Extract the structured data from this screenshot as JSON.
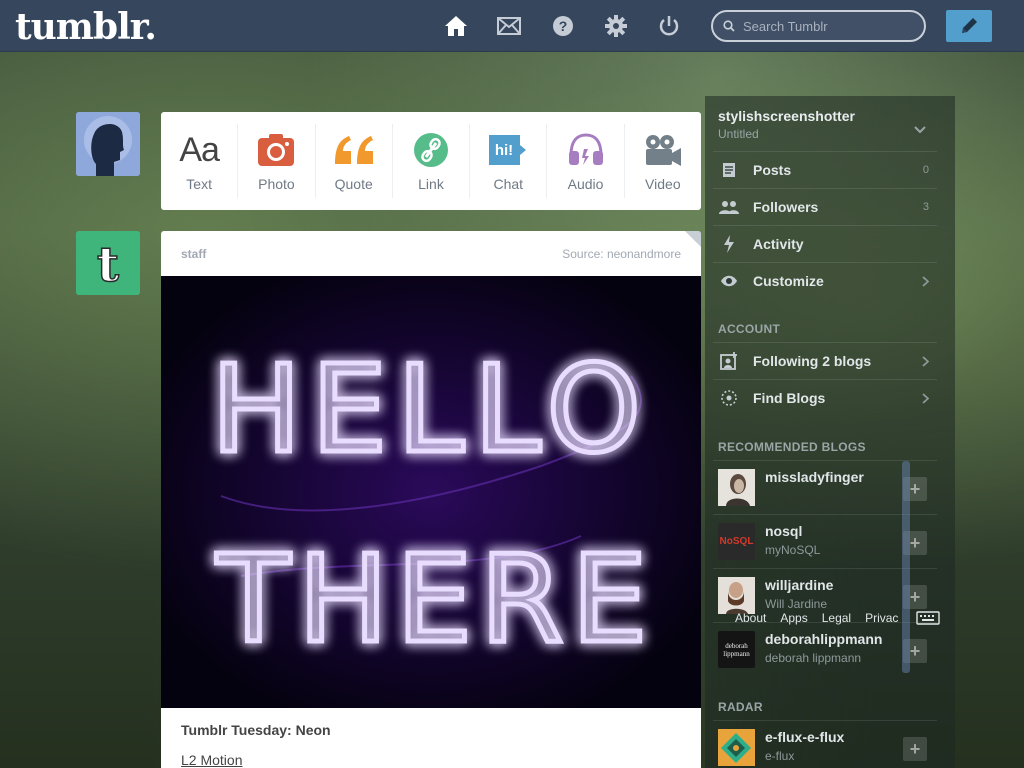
{
  "header": {
    "logo": "tumblr.",
    "search_placeholder": "Search Tumblr",
    "nav_icons": [
      "home-icon",
      "mail-icon",
      "help-icon",
      "gear-icon",
      "power-icon"
    ],
    "compose_icon": "pencil-icon"
  },
  "post_types": [
    {
      "label": "Text",
      "icon": "text-icon"
    },
    {
      "label": "Photo",
      "icon": "camera-icon"
    },
    {
      "label": "Quote",
      "icon": "quote-icon"
    },
    {
      "label": "Link",
      "icon": "link-icon"
    },
    {
      "label": "Chat",
      "icon": "chat-icon"
    },
    {
      "label": "Audio",
      "icon": "headphones-icon"
    },
    {
      "label": "Video",
      "icon": "video-camera-icon"
    }
  ],
  "post": {
    "author": "staff",
    "source": "Source: neonandmore",
    "image_text_line1": "HELLO",
    "image_text_line2": "THERE",
    "title": "Tumblr Tuesday: Neon",
    "link": "L2 Motion"
  },
  "sidebar": {
    "blog_name": "stylishscreenshotter",
    "blog_sub": "Untitled",
    "menu": [
      {
        "label": "Posts",
        "count": "0",
        "icon": "posts-icon"
      },
      {
        "label": "Followers",
        "count": "3",
        "icon": "followers-icon"
      },
      {
        "label": "Activity",
        "count": "",
        "icon": "activity-icon"
      },
      {
        "label": "Customize",
        "count": "",
        "icon": "eye-icon"
      }
    ],
    "account_heading": "ACCOUNT",
    "account": [
      {
        "label": "Following 2 blogs",
        "icon": "following-icon"
      },
      {
        "label": "Find Blogs",
        "icon": "compass-icon"
      }
    ],
    "recommended_heading": "RECOMMENDED BLOGS",
    "recommended": [
      {
        "name": "missladyfinger",
        "sub": ""
      },
      {
        "name": "nosql",
        "sub": "myNoSQL",
        "thumb_text": "NoSQL"
      },
      {
        "name": "willjardine",
        "sub": "Will Jardine"
      },
      {
        "name": "deborahlippmann",
        "sub": "deborah lippmann",
        "thumb_text": "deborah lippmann"
      }
    ],
    "footer_links": [
      "About",
      "Apps",
      "Legal",
      "Privac"
    ],
    "radar_heading": "RADAR",
    "radar": {
      "name": "e-flux-e-flux",
      "sub": "e-flux"
    }
  },
  "colors": {
    "header_bg": "#36465d",
    "compose_bg": "#529ecc",
    "text_icon": "#444444",
    "photo_icon": "#d95e40",
    "quote_icon": "#f2992e",
    "link_icon": "#56bc8a",
    "chat_icon": "#529ecc",
    "audio_icon": "#a77dc2",
    "video_icon": "#748089",
    "neon": "#a070ff"
  }
}
